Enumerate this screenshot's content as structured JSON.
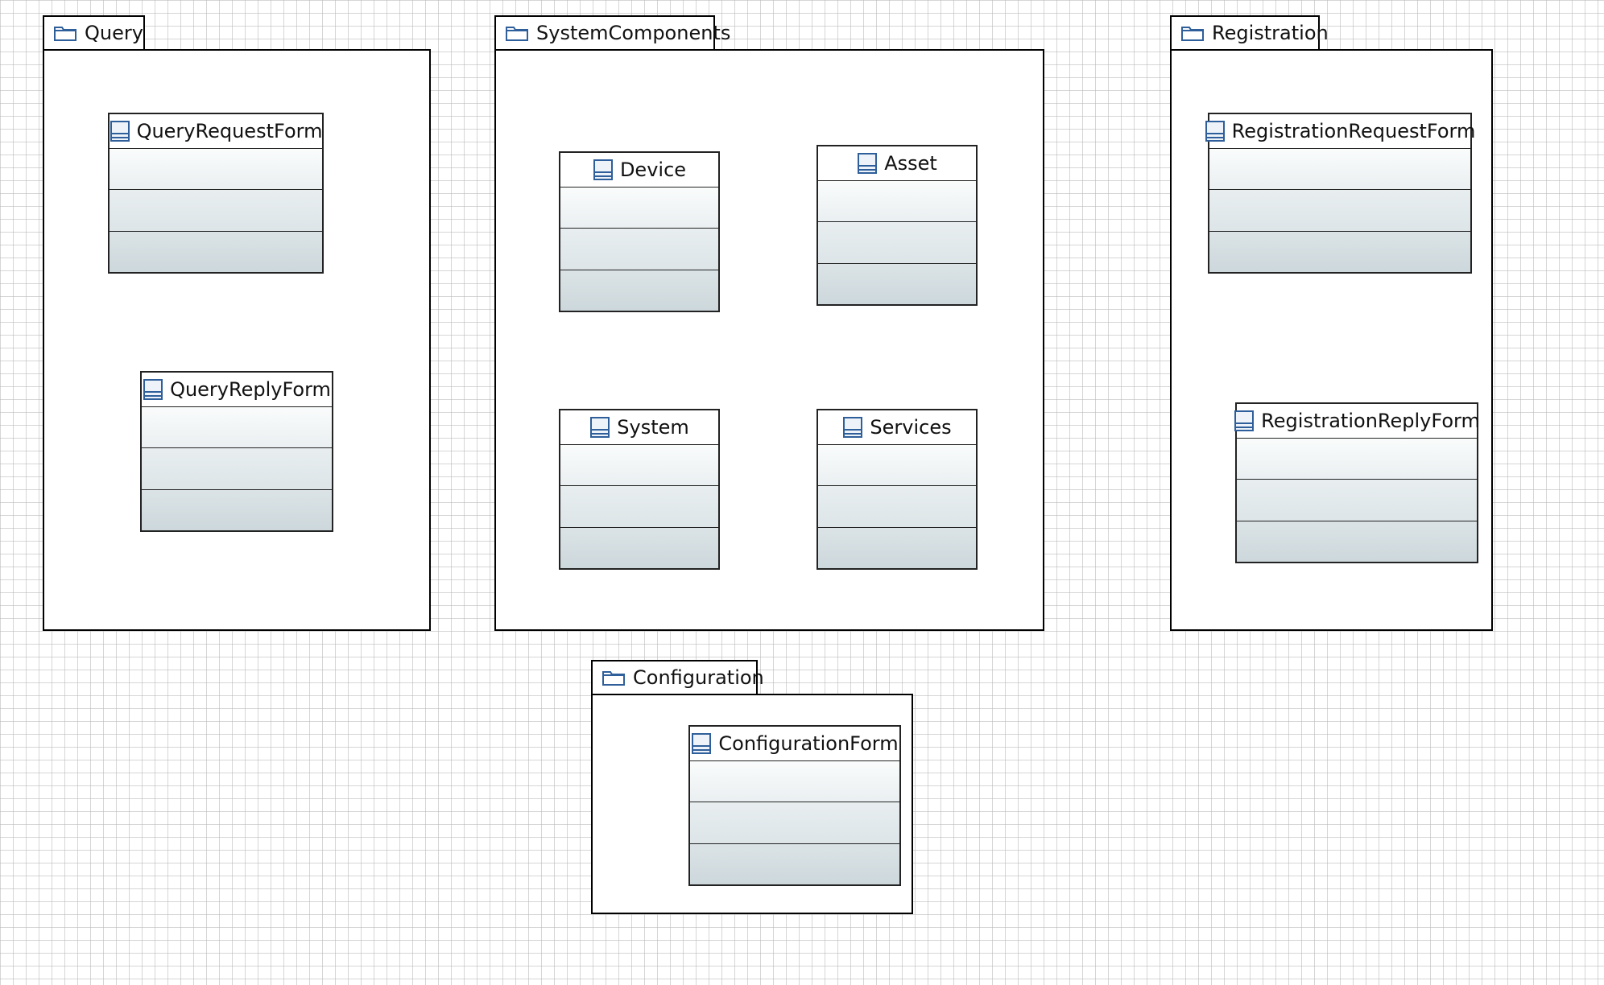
{
  "packages": {
    "query": {
      "name": "Query",
      "classes": {
        "request": "QueryRequestForm",
        "reply": "QueryReplyForm"
      }
    },
    "system_components": {
      "name": "SystemComponents",
      "classes": {
        "device": "Device",
        "asset": "Asset",
        "system": "System",
        "services": "Services"
      }
    },
    "registration": {
      "name": "Registration",
      "classes": {
        "request": "RegistrationRequestForm",
        "reply": "RegistrationReplyForm"
      }
    },
    "configuration": {
      "name": "Configuration",
      "classes": {
        "form": "ConfigurationForm"
      }
    }
  },
  "icons": {
    "package": "folder-icon",
    "class": "class-icon"
  },
  "colors": {
    "icon_stroke": "#2f5f9a",
    "border": "#000000"
  }
}
